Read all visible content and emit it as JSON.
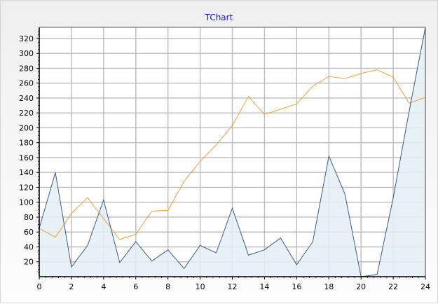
{
  "chart_data": {
    "type": "area",
    "title": "TChart",
    "xlabel": "",
    "ylabel": "",
    "xlim": [
      0,
      24
    ],
    "ylim": [
      0,
      335
    ],
    "x_ticks": [
      0,
      2,
      4,
      6,
      8,
      10,
      12,
      14,
      16,
      18,
      20,
      22,
      24
    ],
    "y_ticks": [
      20,
      40,
      60,
      80,
      100,
      120,
      140,
      160,
      180,
      200,
      220,
      240,
      260,
      280,
      300,
      320
    ],
    "grid": true,
    "legend": "none",
    "x": [
      0,
      1,
      2,
      3,
      4,
      5,
      6,
      7,
      8,
      9,
      10,
      11,
      12,
      13,
      14,
      15,
      16,
      17,
      18,
      19,
      20,
      21,
      22,
      23,
      24
    ],
    "series": [
      {
        "type": "line",
        "color": "#f0a040",
        "values": [
          65,
          53,
          85,
          106,
          78,
          50,
          57,
          88,
          89,
          128,
          155,
          177,
          203,
          242,
          218,
          225,
          232,
          256,
          269,
          266,
          273,
          278,
          268,
          233,
          241
        ]
      },
      {
        "type": "area",
        "color": "#3c5a8c",
        "fill": "#e4eef4",
        "values": [
          65,
          140,
          13,
          42,
          103,
          19,
          47,
          21,
          36,
          11,
          42,
          32,
          92,
          29,
          36,
          52,
          16,
          47,
          162,
          111,
          0,
          3,
          106,
          223,
          335
        ]
      }
    ]
  }
}
